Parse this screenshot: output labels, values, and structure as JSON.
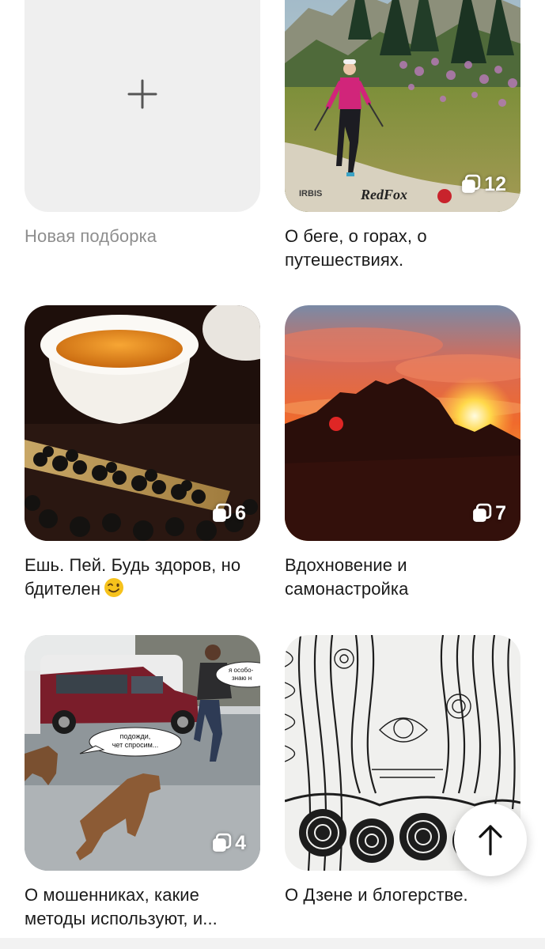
{
  "new_collection": {
    "label": "Новая подборка",
    "icon": "plus-icon"
  },
  "collections": [
    {
      "title": "О беге, о горах, о путешествиях.",
      "count": "12"
    },
    {
      "title": "Ешь. Пей. Будь здоров, но бдителен",
      "emoji": "winking-face-emoji",
      "count": "6"
    },
    {
      "title": "Вдохновение и самонастройка",
      "count": "7"
    },
    {
      "title": "О мошенниках, какие методы используют, и...",
      "count": "4"
    },
    {
      "title": "О Дзене и блогерстве."
    }
  ],
  "photo_text": {
    "brand_1": "IRBIS",
    "brand_2": "RedFox",
    "bubble_1": "подожди,\nчет спросим...",
    "bubble_2": "я особо-\nзнаю н"
  },
  "scroll_top": {
    "icon": "arrow-up-icon"
  },
  "colors": {
    "placeholder_bg": "#efefef",
    "title_text": "#1a1a1a",
    "muted_text": "#8e8e8e",
    "badge_text": "#ffffff"
  }
}
